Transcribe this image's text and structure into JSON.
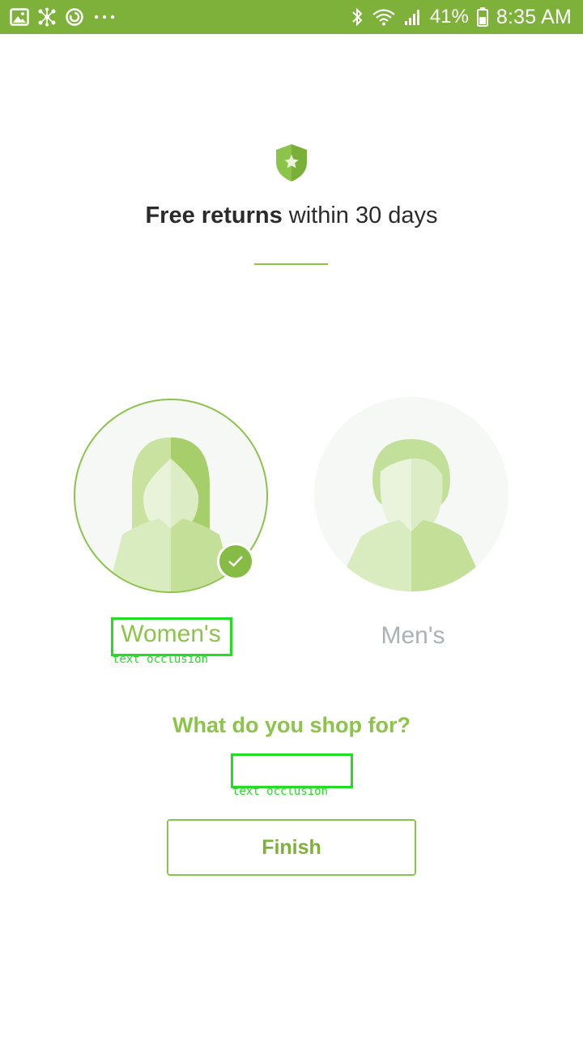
{
  "status_bar": {
    "battery": "41%",
    "time": "8:35 AM"
  },
  "header": {
    "title_bold": "Free returns",
    "title_rest": " within 30 days"
  },
  "genders": [
    {
      "label": "Women's",
      "selected": true
    },
    {
      "label": "Men's",
      "selected": false
    }
  ],
  "prompt": {
    "question": "What do you shop for?"
  },
  "occlusions": [
    {
      "label": "text occlusion"
    },
    {
      "label": "text occlusion"
    }
  ],
  "actions": {
    "finish_label": "Finish"
  },
  "colors": {
    "status_bar": "#7db13a",
    "accent": "#8cc34b",
    "inactive_label": "#aab2b8",
    "occlusion": "#22dd22"
  },
  "icons": {
    "status_left": [
      "image-icon",
      "network-hub-icon",
      "sync-icon",
      "more-dots-icon"
    ],
    "status_right": [
      "bluetooth-icon",
      "wifi-icon",
      "signal-icon",
      "battery-icon"
    ],
    "header": "shield-star-icon",
    "selected": "checkmark-icon"
  }
}
